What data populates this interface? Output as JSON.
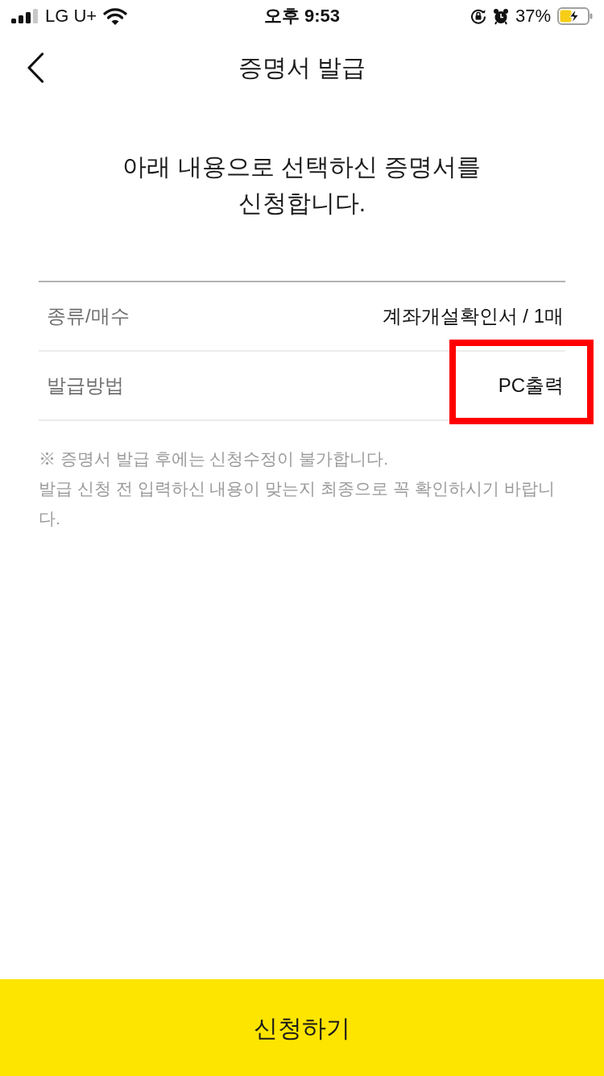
{
  "status_bar": {
    "carrier": "LG U+",
    "time": "오후 9:53",
    "battery": "37%"
  },
  "header": {
    "title": "증명서 발급"
  },
  "heading": "아래 내용으로 선택하신 증명서를\n신청합니다.",
  "details": {
    "rows": [
      {
        "label": "종류/매수",
        "value": "계좌개설확인서 / 1매",
        "highlighted": false
      },
      {
        "label": "발급방법",
        "value": "PC출력",
        "highlighted": true
      }
    ]
  },
  "notes": [
    "※ 증명서 발급 후에는 신청수정이 불가합니다.",
    "발급 신청 전 입력하신 내용이 맞는지 최종으로 꼭 확인하시기 바랍니다."
  ],
  "submit_button": {
    "label": "신청하기"
  }
}
